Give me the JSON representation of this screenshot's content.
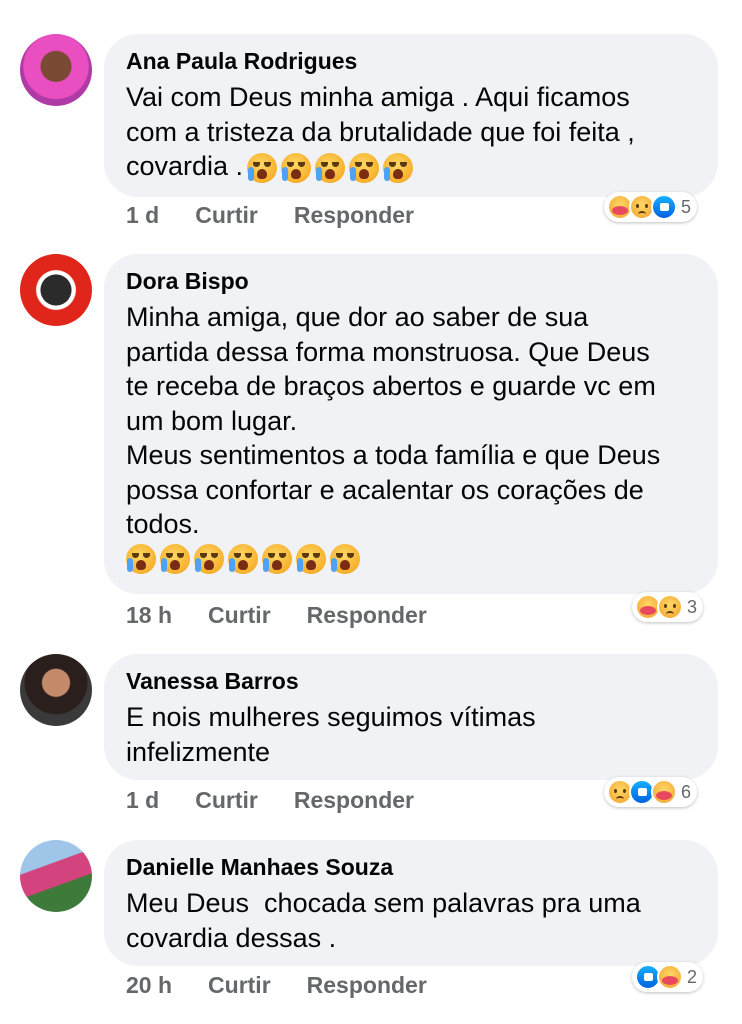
{
  "comments": [
    {
      "author": "Ana Paula Rodrigues",
      "text": "Vai com Deus minha amiga . Aqui ficamos\ncom a tristeza da brutalidade que foi feita ,\ncovardia .",
      "emoji_count": 5,
      "time": "1 d",
      "like_label": "Curtir",
      "reply_label": "Responder",
      "reaction_icons": [
        "care-reaction-icon",
        "sad-reaction-icon",
        "like-reaction-icon"
      ],
      "reaction_count": "5"
    },
    {
      "author": "Dora Bispo",
      "text": "Minha amiga, que dor ao saber de sua\npartida dessa forma monstruosa. Que Deus\nte receba de braços abertos e guarde vc em\num bom lugar.\nMeus sentimentos a toda família e que Deus\npossa confortar e acalentar os corações de\ntodos.",
      "emoji_count": 7,
      "time": "18 h",
      "like_label": "Curtir",
      "reply_label": "Responder",
      "reaction_icons": [
        "care-reaction-icon",
        "sad-reaction-icon"
      ],
      "reaction_count": "3"
    },
    {
      "author": "Vanessa Barros",
      "text": "E nois mulheres seguimos vítimas\ninfelizmente",
      "emoji_count": 0,
      "time": "1 d",
      "like_label": "Curtir",
      "reply_label": "Responder",
      "reaction_icons": [
        "sad-reaction-icon",
        "like-reaction-icon",
        "care-reaction-icon"
      ],
      "reaction_count": "6"
    },
    {
      "author": "Danielle Manhaes Souza",
      "text": "Meu Deus  chocada sem palavras pra uma\ncovardia dessas .",
      "emoji_count": 0,
      "time": "20 h",
      "like_label": "Curtir",
      "reply_label": "Responder",
      "reaction_icons": [
        "like-reaction-icon",
        "care-reaction-icon"
      ],
      "reaction_count": "2"
    }
  ],
  "emoji_icon": "loudly-crying-face-icon"
}
